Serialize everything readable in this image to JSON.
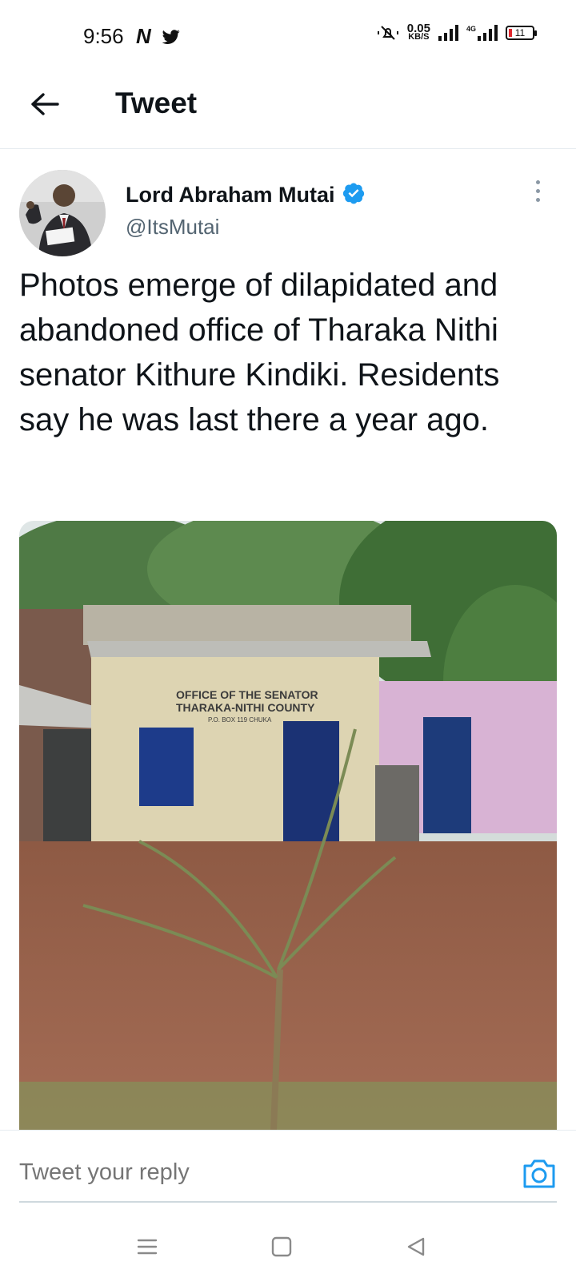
{
  "status_bar": {
    "time": "9:56",
    "speed_value": "0.05",
    "speed_unit": "KB/S",
    "network": "4G",
    "battery": "11",
    "left_icons": [
      "netflix-n-icon",
      "twitter-bird-icon"
    ],
    "right_icons": [
      "mute-icon",
      "signal-icon",
      "signal-4g-icon",
      "battery-icon"
    ]
  },
  "header": {
    "title": "Tweet",
    "back_icon": "arrow-left-icon"
  },
  "tweet": {
    "author_name": "Lord Abraham Mutai",
    "author_handle": "@ItsMutai",
    "verified": true,
    "text": "Photos emerge of dilapidated and abandoned office of Tharaka Nithi senator Kithure Kindiki. Residents say he was last there a year ago.",
    "media": {
      "sign_line1": "OFFICE OF THE SENATOR",
      "sign_line2": "THARAKA-NITHI COUNTY",
      "sign_line3": "P.O. BOX 119 CHUKA"
    }
  },
  "reply": {
    "placeholder": "Tweet your reply",
    "camera_icon": "camera-icon"
  },
  "nav": {
    "icons": [
      "menu-icon",
      "home-square-icon",
      "back-triangle-icon"
    ]
  },
  "colors": {
    "accent": "#1d9bf0",
    "text": "#0f1419",
    "secondary": "#536471",
    "battery_low": "#e0282e"
  }
}
